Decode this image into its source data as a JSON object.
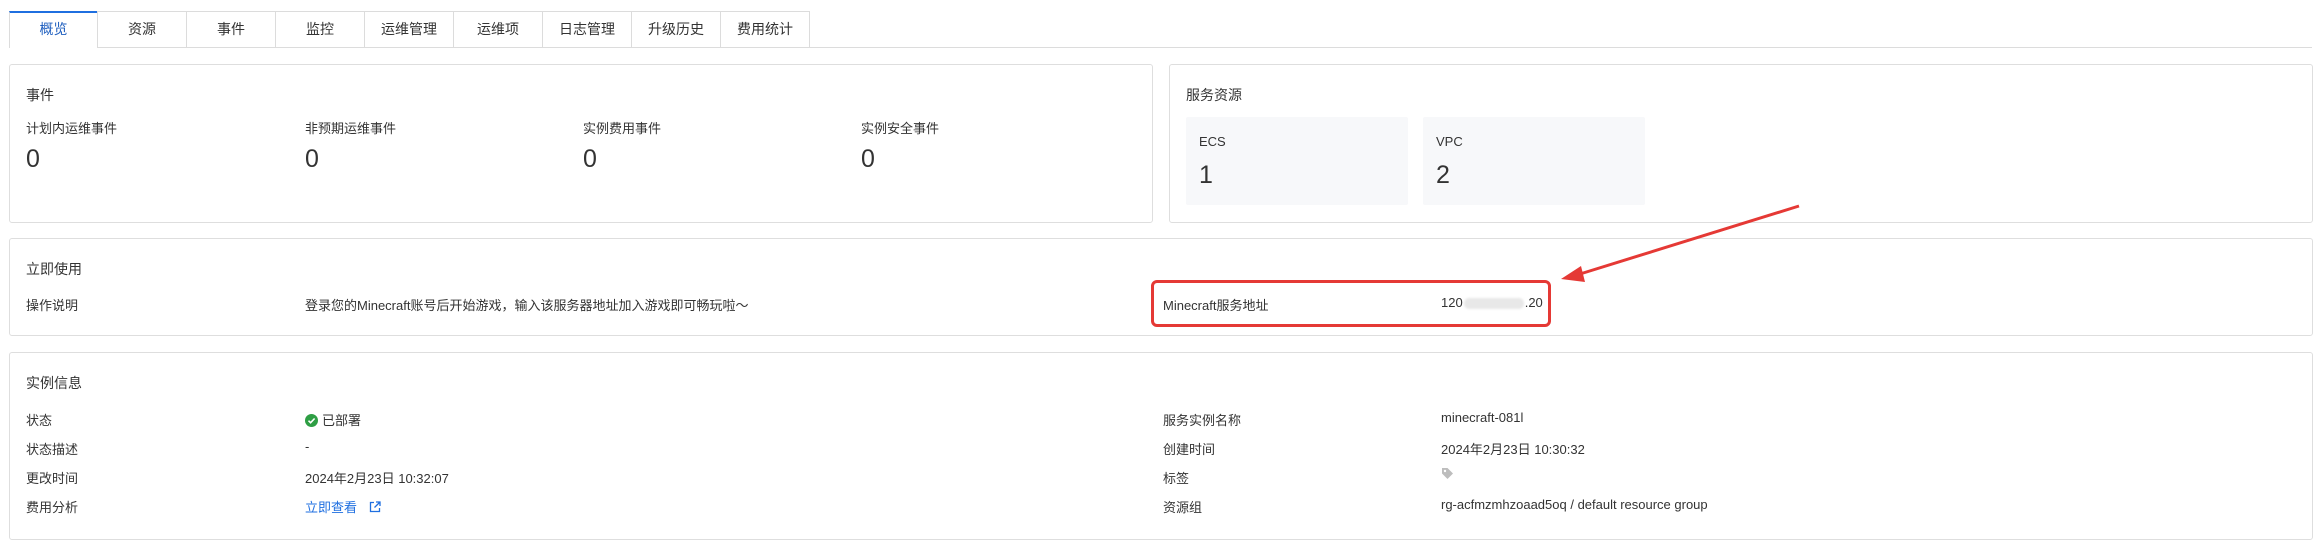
{
  "tabs": [
    "概览",
    "资源",
    "事件",
    "监控",
    "运维管理",
    "运维项",
    "日志管理",
    "升级历史",
    "费用统计"
  ],
  "events": {
    "title": "事件",
    "items": [
      {
        "label": "计划内运维事件",
        "value": "0"
      },
      {
        "label": "非预期运维事件",
        "value": "0"
      },
      {
        "label": "实例费用事件",
        "value": "0"
      },
      {
        "label": "实例安全事件",
        "value": "0"
      }
    ]
  },
  "resources": {
    "title": "服务资源",
    "items": [
      {
        "label": "ECS",
        "value": "1"
      },
      {
        "label": "VPC",
        "value": "2"
      }
    ]
  },
  "usage": {
    "title": "立即使用",
    "desc_label": "操作说明",
    "desc_value": "登录您的Minecraft账号后开始游戏，输入该服务器地址加入游戏即可畅玩啦～",
    "address_label": "Minecraft服务地址",
    "address_prefix": "120",
    "address_suffix": ".20"
  },
  "instance": {
    "title": "实例信息",
    "status_label": "状态",
    "status_value": "已部署",
    "status_desc_label": "状态描述",
    "status_desc_value": "-",
    "updated_label": "更改时间",
    "updated_value": "2024年2月23日 10:32:07",
    "cost_label": "费用分析",
    "cost_value": "立即查看",
    "name_label": "服务实例名称",
    "name_value": "minecraft-081l",
    "created_label": "创建时间",
    "created_value": "2024年2月23日 10:30:32",
    "tag_label": "标签",
    "rg_label": "资源组",
    "rg_value": "rg-acfmzmhzoaad5oq / default resource group"
  },
  "colors": {
    "accent": "#1f6fe0",
    "success": "#2e9e44",
    "annotation": "#e53935"
  }
}
